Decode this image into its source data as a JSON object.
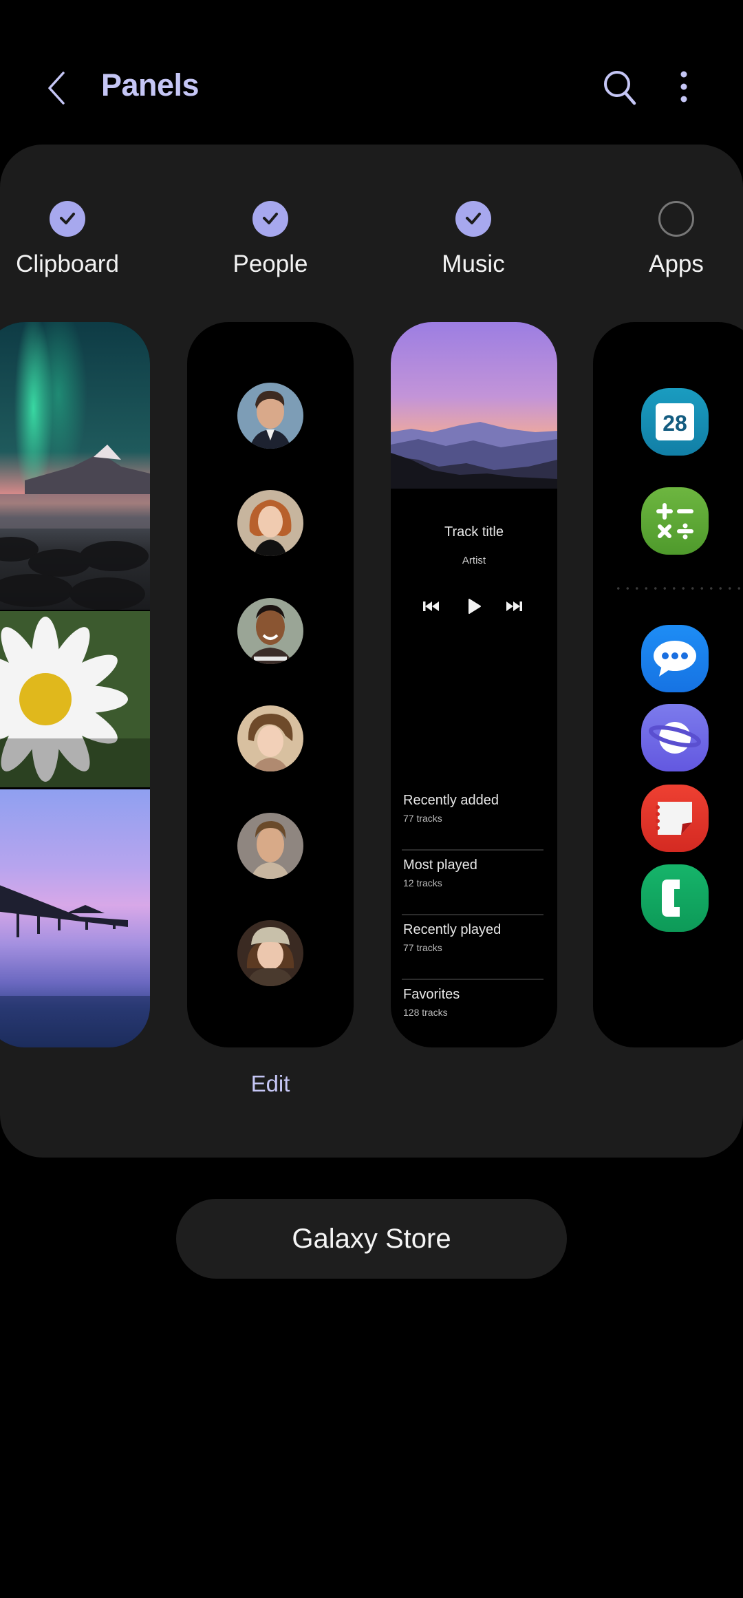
{
  "header": {
    "title": "Panels",
    "back_icon": "chevron-left-icon",
    "search_icon": "search-icon",
    "more_icon": "more-vertical-icon"
  },
  "accent_color": "#a7a8ee",
  "panels": [
    {
      "label": "Clipboard",
      "selected": true
    },
    {
      "label": "People",
      "selected": true
    },
    {
      "label": "Music",
      "selected": true
    },
    {
      "label": "Apps",
      "selected": false
    }
  ],
  "music": {
    "track_title": "Track title",
    "artist": "Artist",
    "controls": [
      "previous-icon",
      "play-icon",
      "next-icon"
    ],
    "playlists": [
      {
        "name": "Recently added",
        "count": "77 tracks"
      },
      {
        "name": "Most played",
        "count": "12 tracks"
      },
      {
        "name": "Recently played",
        "count": "77 tracks"
      },
      {
        "name": "Favorites",
        "count": "128 tracks"
      }
    ]
  },
  "apps": {
    "calendar_day": "28",
    "items": [
      "calendar",
      "calculator",
      "messages",
      "internet",
      "notes",
      "phone"
    ]
  },
  "edit_label": "Edit",
  "store_button": "Galaxy Store"
}
